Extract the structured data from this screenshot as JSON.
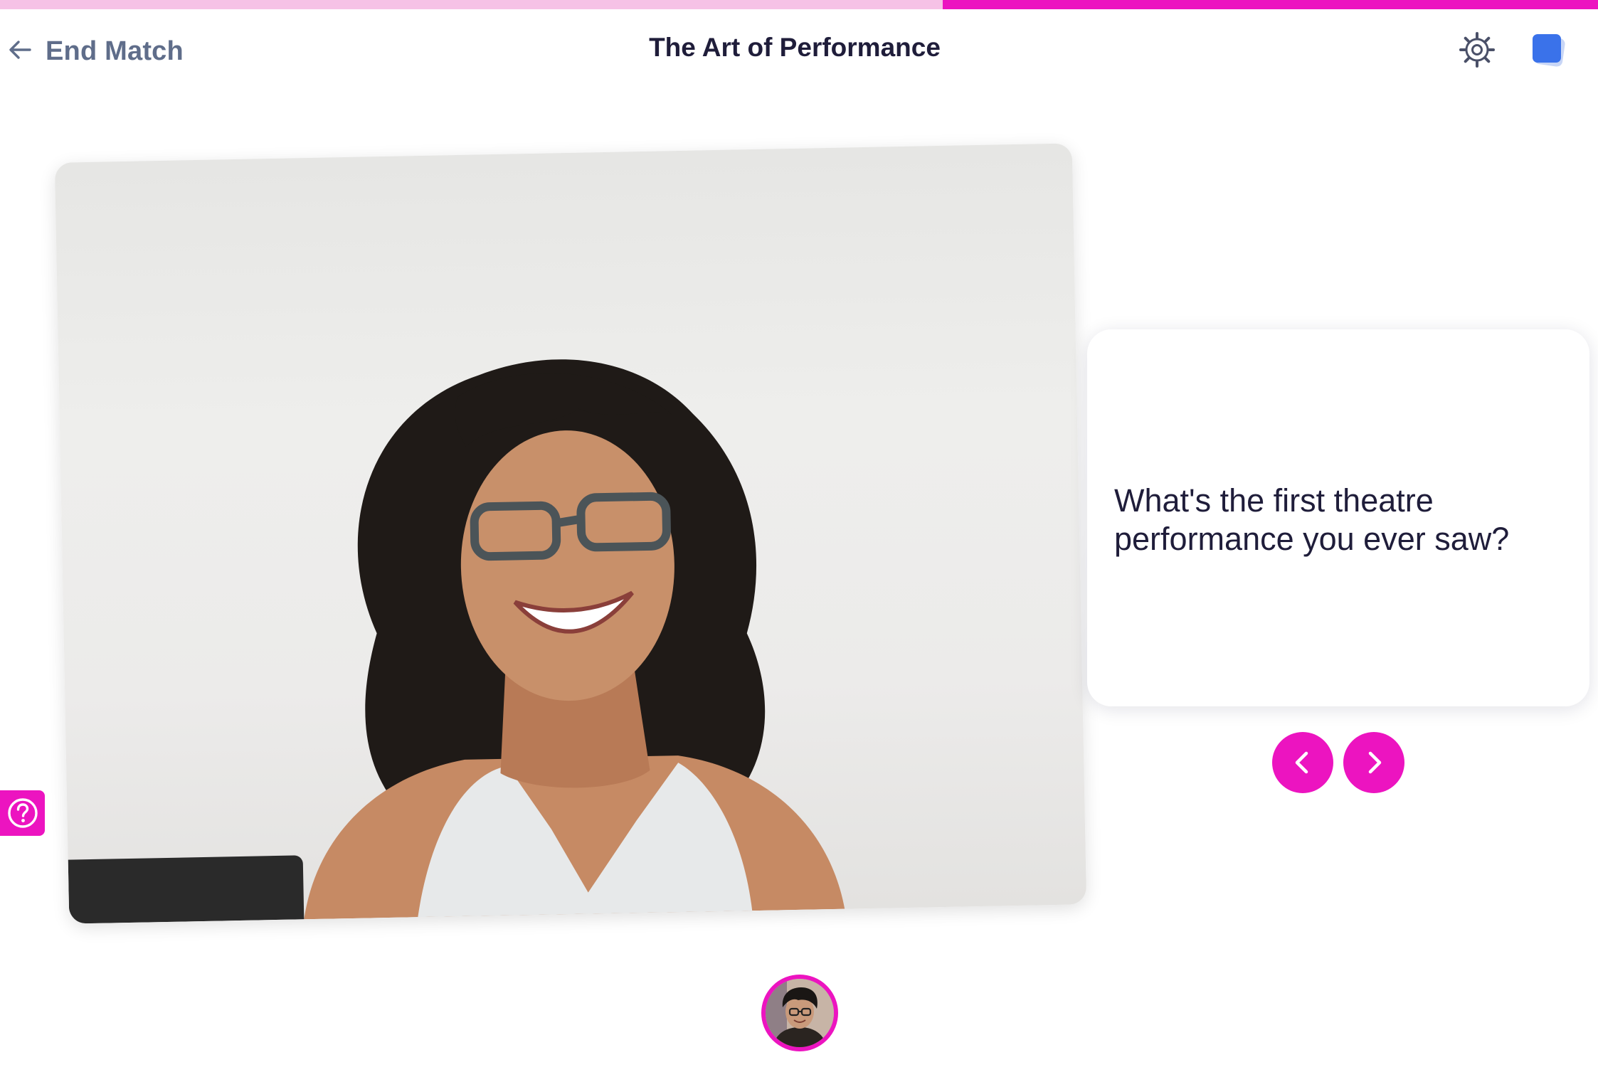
{
  "progress": {
    "fraction": 0.41
  },
  "header": {
    "back_icon": "arrow-left-icon",
    "end_match_label": "End Match",
    "title": "The Art of Performance",
    "settings_icon": "gear-icon",
    "cards_icon": "cards-stack-icon"
  },
  "question": {
    "text": "What's the first theatre performance you ever saw?"
  },
  "navigation": {
    "prev_icon": "chevron-left-icon",
    "next_icon": "chevron-right-icon"
  },
  "help": {
    "icon": "question-mark-icon"
  },
  "colors": {
    "accent": "#ec14c0",
    "progress_track": "#f6c2e6",
    "title": "#1f1d3a",
    "end_match": "#5f6d8a",
    "cards_blue": "#3a72ea"
  }
}
